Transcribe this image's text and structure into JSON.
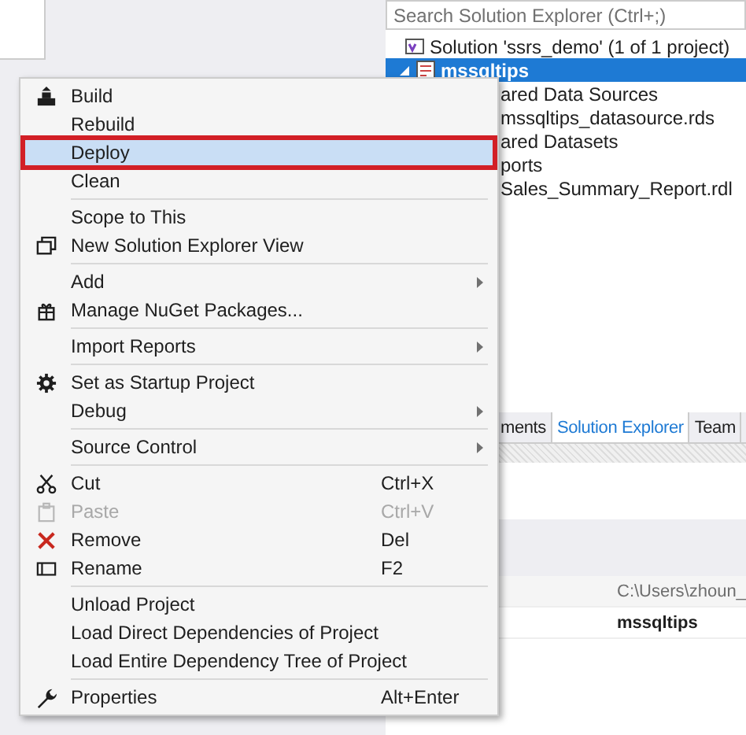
{
  "solution_explorer": {
    "search": {
      "placeholder": "Search Solution Explorer (Ctrl+;)"
    },
    "tree": [
      {
        "label": "Solution 'ssrs_demo' (1 of 1 project)",
        "selected": false,
        "children": [
          {
            "label": "mssqltips",
            "selected": true,
            "expanded": true,
            "children": [
              {
                "label": "ared Data Sources",
                "selected": false,
                "children": [
                  {
                    "label": "mssqltips_datasource.rds",
                    "selected": false
                  }
                ]
              },
              {
                "label": "ared Datasets",
                "selected": false
              },
              {
                "label": "ports",
                "selected": false,
                "children": [
                  {
                    "label": "Sales_Summary_Report.rdl",
                    "selected": false
                  }
                ]
              }
            ]
          }
        ]
      }
    ],
    "tabs": [
      {
        "label": "ments",
        "selected": false
      },
      {
        "label": "Solution Explorer",
        "selected": true
      },
      {
        "label": "Team",
        "selected": false
      }
    ]
  },
  "properties": {
    "rows": [
      {
        "value": "C:\\Users\\zhoun_",
        "modified": false
      },
      {
        "value": "mssqltips",
        "modified": true
      }
    ]
  },
  "context_menu": {
    "groups": [
      [
        {
          "label": "Build",
          "selected": false,
          "disabled": false,
          "submenu": false
        },
        {
          "label": "Rebuild",
          "selected": false,
          "disabled": false,
          "submenu": false
        },
        {
          "label": "Deploy",
          "selected": true,
          "disabled": false,
          "submenu": false
        },
        {
          "label": "Clean",
          "selected": false,
          "disabled": false,
          "submenu": false
        }
      ],
      [
        {
          "label": "Scope to This",
          "selected": false,
          "disabled": false,
          "submenu": false
        },
        {
          "label": "New Solution Explorer View",
          "selected": false,
          "disabled": false,
          "submenu": false
        }
      ],
      [
        {
          "label": "Add",
          "selected": false,
          "disabled": false,
          "submenu": true
        },
        {
          "label": "Manage NuGet Packages...",
          "selected": false,
          "disabled": false,
          "submenu": false
        }
      ],
      [
        {
          "label": "Import Reports",
          "selected": false,
          "disabled": false,
          "submenu": true
        }
      ],
      [
        {
          "label": "Set as Startup Project",
          "selected": false,
          "disabled": false,
          "submenu": false
        },
        {
          "label": "Debug",
          "selected": false,
          "disabled": false,
          "submenu": true
        }
      ],
      [
        {
          "label": "Source Control",
          "selected": false,
          "disabled": false,
          "submenu": true
        }
      ],
      [
        {
          "label": "Cut",
          "shortcut": "Ctrl+X",
          "selected": false,
          "disabled": false,
          "submenu": false
        },
        {
          "label": "Paste",
          "shortcut": "Ctrl+V",
          "selected": false,
          "disabled": true,
          "submenu": false
        },
        {
          "label": "Remove",
          "shortcut": "Del",
          "selected": false,
          "disabled": false,
          "submenu": false
        },
        {
          "label": "Rename",
          "shortcut": "F2",
          "selected": false,
          "disabled": false,
          "submenu": false
        }
      ],
      [
        {
          "label": "Unload Project",
          "selected": false,
          "disabled": false,
          "submenu": false
        },
        {
          "label": "Load Direct Dependencies of Project",
          "selected": false,
          "disabled": false,
          "submenu": false
        },
        {
          "label": "Load Entire Dependency Tree of Project",
          "selected": false,
          "disabled": false,
          "submenu": false
        }
      ],
      [
        {
          "label": "Properties",
          "shortcut": "Alt+Enter",
          "selected": false,
          "disabled": false,
          "submenu": false
        }
      ]
    ]
  }
}
